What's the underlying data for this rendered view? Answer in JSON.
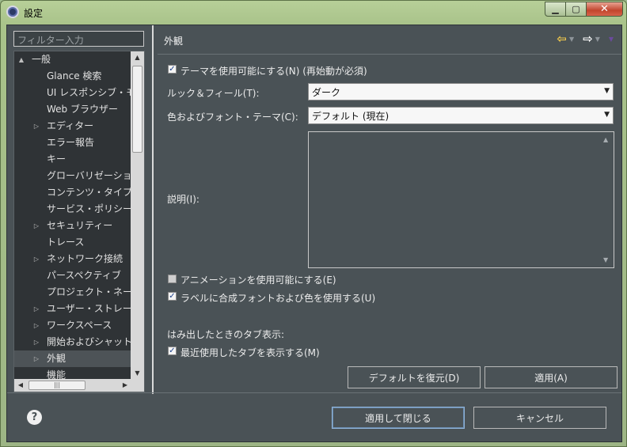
{
  "window": {
    "title": "設定"
  },
  "filter": {
    "placeholder": "フィルター入力"
  },
  "tree": [
    {
      "label": "一般",
      "level": 0,
      "twisty": "▲",
      "selected": false
    },
    {
      "label": "Glance 検索",
      "level": 1,
      "twisty": "",
      "selected": false
    },
    {
      "label": "UI レスポンシブ・モ",
      "level": 1,
      "twisty": "",
      "selected": false
    },
    {
      "label": "Web ブラウザー",
      "level": 1,
      "twisty": "",
      "selected": false
    },
    {
      "label": "エディター",
      "level": 1,
      "twisty": "▷",
      "selected": false
    },
    {
      "label": "エラー報告",
      "level": 1,
      "twisty": "",
      "selected": false
    },
    {
      "label": "キー",
      "level": 1,
      "twisty": "",
      "selected": false
    },
    {
      "label": "グローバリゼーショ",
      "level": 1,
      "twisty": "",
      "selected": false
    },
    {
      "label": "コンテンツ・タイプ",
      "level": 1,
      "twisty": "",
      "selected": false
    },
    {
      "label": "サービス・ポリシー",
      "level": 1,
      "twisty": "",
      "selected": false
    },
    {
      "label": "セキュリティー",
      "level": 1,
      "twisty": "▷",
      "selected": false
    },
    {
      "label": "トレース",
      "level": 1,
      "twisty": "",
      "selected": false
    },
    {
      "label": "ネットワーク接続",
      "level": 1,
      "twisty": "▷",
      "selected": false
    },
    {
      "label": "パースペクティブ",
      "level": 1,
      "twisty": "",
      "selected": false
    },
    {
      "label": "プロジェクト・ネー",
      "level": 1,
      "twisty": "",
      "selected": false
    },
    {
      "label": "ユーザー・ストレー",
      "level": 1,
      "twisty": "▷",
      "selected": false
    },
    {
      "label": "ワークスペース",
      "level": 1,
      "twisty": "▷",
      "selected": false
    },
    {
      "label": "開始およびシャット",
      "level": 1,
      "twisty": "▷",
      "selected": false
    },
    {
      "label": "外観",
      "level": 1,
      "twisty": "▷",
      "selected": true
    },
    {
      "label": "機能",
      "level": 1,
      "twisty": "",
      "selected": false
    }
  ],
  "page": {
    "title": "外観",
    "theme_checkbox": {
      "label": "テーマを使用可能にする(N) (再始動が必須)",
      "checked": true
    },
    "look_feel": {
      "label": "ルック＆フィール(T):",
      "value": "ダーク"
    },
    "color_font": {
      "label": "色およびフォント・テーマ(C):",
      "value": "デフォルト (現在)"
    },
    "description_label": "説明(I):",
    "animation_checkbox": {
      "label": "アニメーションを使用可能にする(E)",
      "checked": false
    },
    "mixed_fonts_checkbox": {
      "label": "ラベルに合成フォントおよび色を使用する(U)",
      "checked": true
    },
    "tab_section_label": "はみ出したときのタブ表示:",
    "recent_tabs_checkbox": {
      "label": "最近使用したタブを表示する(M)",
      "checked": true
    },
    "restore_defaults": "デフォルトを復元(D)",
    "apply": "適用(A)"
  },
  "footer": {
    "apply_close": "適用して閉じる",
    "cancel": "キャンセル"
  },
  "colors": {
    "back_arrow": "#f2c94c",
    "forward_arrow": "#ffffff",
    "menu_caret": "#6b4a9e"
  }
}
